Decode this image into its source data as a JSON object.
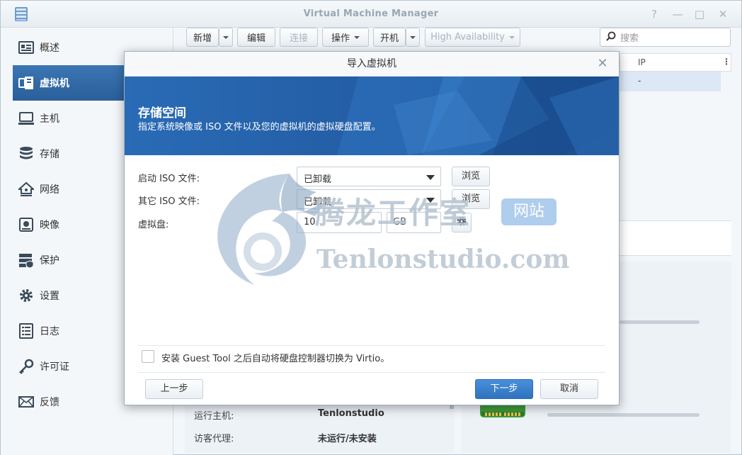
{
  "window": {
    "title": "Virtual Machine Manager",
    "controls": [
      "?",
      "—",
      "□",
      "✕"
    ]
  },
  "sidebar": {
    "items": [
      {
        "label": "概述",
        "icon": "overview-icon"
      },
      {
        "label": "虚拟机",
        "icon": "virtual-machine-icon",
        "active": true
      },
      {
        "label": "主机",
        "icon": "host-icon"
      },
      {
        "label": "存储",
        "icon": "storage-icon"
      },
      {
        "label": "网络",
        "icon": "network-icon"
      },
      {
        "label": "映像",
        "icon": "image-icon"
      },
      {
        "label": "保护",
        "icon": "protection-icon"
      },
      {
        "label": "设置",
        "icon": "settings-gear-icon"
      },
      {
        "label": "日志",
        "icon": "log-icon"
      },
      {
        "label": "许可证",
        "icon": "license-key-icon"
      },
      {
        "label": "反馈",
        "icon": "feedback-mail-icon"
      }
    ]
  },
  "toolbar": {
    "new_label": "新增",
    "edit_label": "编辑",
    "connect_label": "连接",
    "action_label": "操作",
    "power_label": "开机",
    "ha_label": "High Availability",
    "search_placeholder": "搜索"
  },
  "grid": {
    "column_ip": "IP",
    "row_ip_value": "-"
  },
  "details": {
    "host_label": "运行主机:",
    "host_value": "Tenlonstudio",
    "agent_label": "访客代理:",
    "agent_value": "未运行/未安装"
  },
  "dialog": {
    "title": "导入虚拟机",
    "banner_title": "存储空间",
    "banner_desc": "指定系统映像或 ISO 文件以及您的虚拟机的虚拟硬盘配置。",
    "boot_iso_label": "启动 ISO 文件:",
    "boot_iso_value": "已卸载",
    "other_iso_label": "其它 ISO 文件:",
    "other_iso_value": "已卸载",
    "browse_label": "浏览",
    "vdisk_label": "虚拟盘:",
    "vdisk_size": "10",
    "vdisk_unit": "GB",
    "guest_tool_label": "安装 Guest Tool 之后自动将硬盘控制器切换为 Virtio。",
    "guest_tool_checked": false,
    "back_label": "上一步",
    "next_label": "下一步",
    "cancel_label": "取消"
  },
  "watermark": {
    "cn_text": "腾龙工作室",
    "badge_text": "网站",
    "en_text": "Tenlonstudio.com"
  },
  "colors": {
    "accent": "#2a5f9a",
    "banner": "#1f5ea8",
    "primary_button": "#2f73c0",
    "selected_row": "#dce8f6"
  }
}
